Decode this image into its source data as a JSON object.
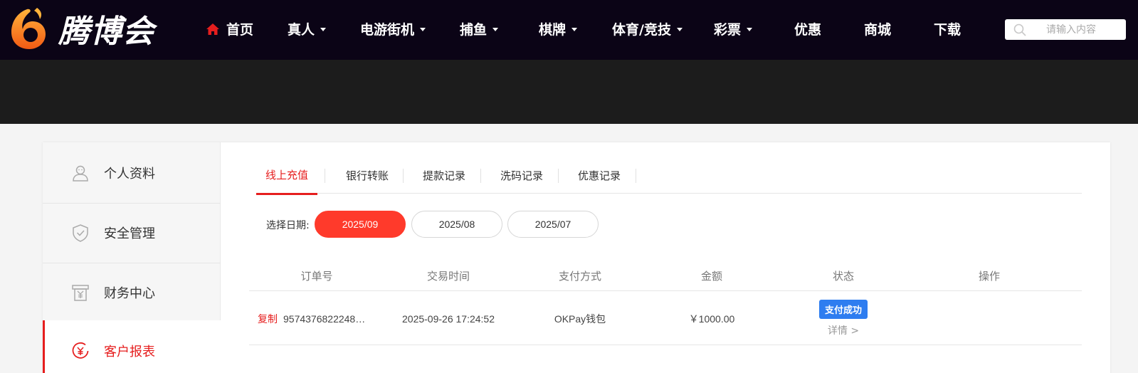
{
  "brand": {
    "name": "腾博会",
    "logo_icon": "flame-logo-icon",
    "accent": "#e61e1e"
  },
  "nav": {
    "items": [
      {
        "label": "首页",
        "icon": "home-icon",
        "dropdown": false
      },
      {
        "label": "真人",
        "dropdown": true
      },
      {
        "label": "电游街机",
        "dropdown": true
      },
      {
        "label": "捕鱼",
        "dropdown": true
      },
      {
        "label": "棋牌",
        "dropdown": true
      },
      {
        "label": "体育/竞技",
        "dropdown": true
      },
      {
        "label": "彩票",
        "dropdown": true
      },
      {
        "label": "优惠",
        "dropdown": false
      },
      {
        "label": "商城",
        "dropdown": false
      },
      {
        "label": "下载",
        "dropdown": false
      }
    ],
    "search_placeholder": "请输入内容"
  },
  "sidebar": {
    "items": [
      {
        "label": "个人资料",
        "icon": "user-icon",
        "active": false
      },
      {
        "label": "安全管理",
        "icon": "shield-icon",
        "active": false
      },
      {
        "label": "财务中心",
        "icon": "finance-icon",
        "active": false
      },
      {
        "label": "客户报表",
        "icon": "yuan-circle-icon",
        "active": true
      }
    ]
  },
  "tabs": [
    {
      "label": "线上充值",
      "active": true
    },
    {
      "label": "银行转账",
      "active": false
    },
    {
      "label": "提款记录",
      "active": false
    },
    {
      "label": "洗码记录",
      "active": false
    },
    {
      "label": "优惠记录",
      "active": false
    }
  ],
  "date_filter": {
    "label": "选择日期:",
    "options": [
      {
        "label": "2025/09",
        "active": true
      },
      {
        "label": "2025/08",
        "active": false
      },
      {
        "label": "2025/07",
        "active": false
      }
    ]
  },
  "table": {
    "columns": [
      "订单号",
      "交易时间",
      "支付方式",
      "金额",
      "状态",
      "操作"
    ],
    "rows": [
      {
        "copy_label": "复制",
        "order_no": "9574376822248…",
        "time": "2025-09-26 17:24:52",
        "method": "OKPay钱包",
        "amount": "￥1000.00",
        "status": "支付成功",
        "detail_label": "详情 >"
      }
    ]
  },
  "colors": {
    "nav_bg": "#0b0416",
    "banner_bg": "#1c1c1c",
    "active_date": "#ff3a2b",
    "status_badge": "#2e7df0"
  }
}
